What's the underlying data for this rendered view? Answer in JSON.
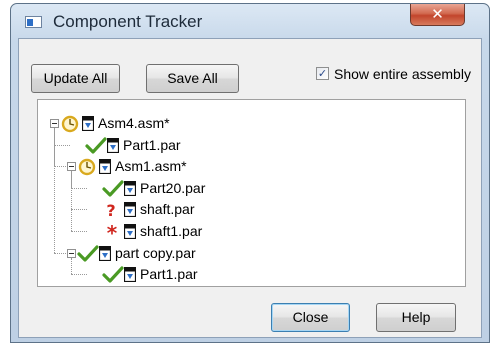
{
  "window": {
    "title": "Component Tracker",
    "title_bar_close_glyph": "✕"
  },
  "toolbar": {
    "update_all_label": "Update All",
    "save_all_label": "Save All",
    "show_entire_assembly": {
      "label": "Show entire assembly",
      "checked": true
    }
  },
  "tree": {
    "nodes": [
      {
        "label": "Asm4.asm*",
        "status": "clock",
        "depth": 0,
        "expanded": true
      },
      {
        "label": "Part1.par",
        "status": "check",
        "depth": 1
      },
      {
        "label": "Asm1.asm*",
        "status": "clock",
        "depth": 1,
        "expanded": true
      },
      {
        "label": "Part20.par",
        "status": "check",
        "depth": 2
      },
      {
        "label": "shaft.par",
        "status": "question",
        "depth": 2
      },
      {
        "label": "shaft1.par",
        "status": "asterisk",
        "depth": 2
      },
      {
        "label": "part copy.par",
        "status": "check",
        "depth": 1,
        "expanded": true
      },
      {
        "label": "Part1.par",
        "status": "check",
        "depth": 2
      }
    ]
  },
  "footer": {
    "close_label": "Close",
    "help_label": "Help"
  },
  "icons": {
    "app": "window-app-icon",
    "check": "green-check-icon",
    "clock": "clock-icon",
    "question": "red-question-icon",
    "asterisk": "red-asterisk-icon",
    "document": "document-icon"
  },
  "colors": {
    "check": "#4a9a24",
    "clock": "#d9a91e",
    "question": "#d0261e",
    "asterisk": "#d0261e",
    "title_close_button": "#c7492e"
  }
}
